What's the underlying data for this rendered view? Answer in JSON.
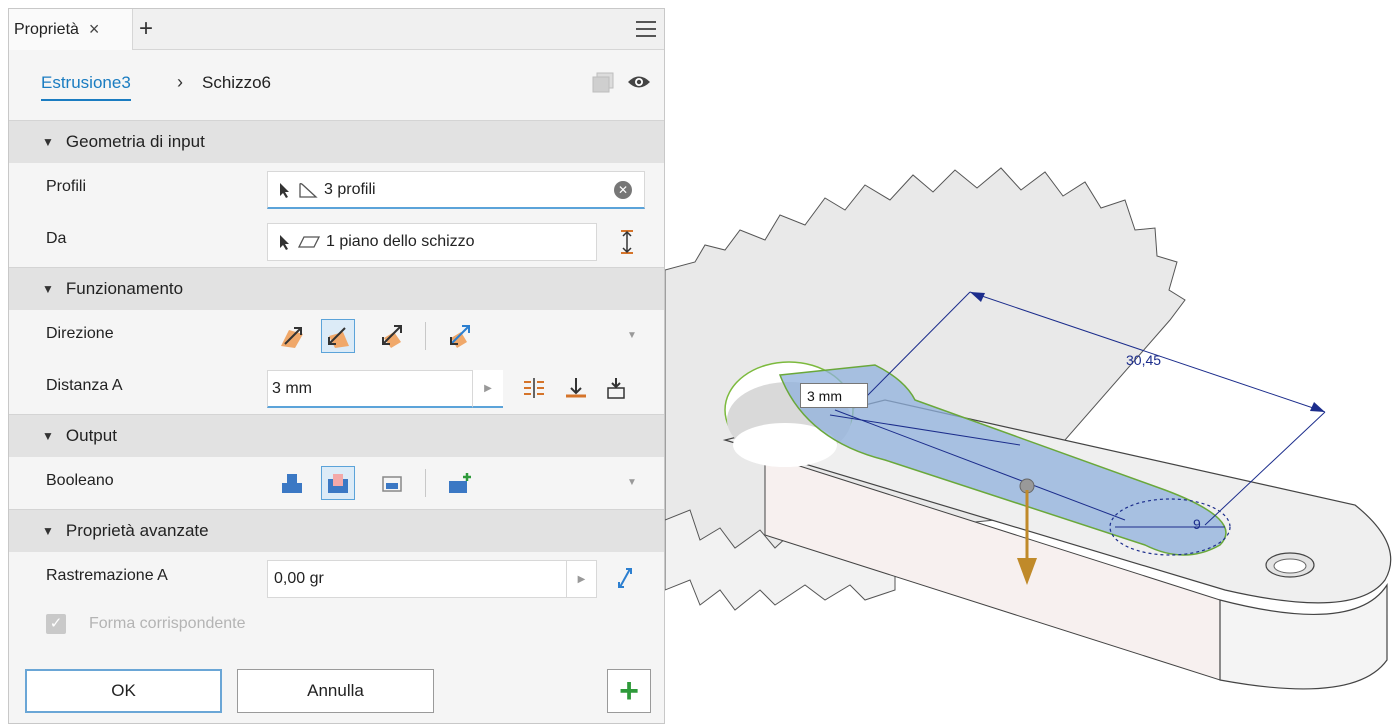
{
  "tab": {
    "label": "Proprietà",
    "close": "×",
    "add": "+"
  },
  "breadcrumb": {
    "link": "Estrusione3",
    "separator": "›",
    "current": "Schizzo6"
  },
  "sections": {
    "input_geometry": "Geometria di input",
    "behavior": "Funzionamento",
    "output": "Output",
    "advanced": "Proprietà avanzate"
  },
  "profiles": {
    "label": "Profili",
    "value": "3 profili"
  },
  "from": {
    "label": "Da",
    "value": "1 piano dello schizzo"
  },
  "direction": {
    "label": "Direzione"
  },
  "distance": {
    "label": "Distanza A",
    "value": "3 mm"
  },
  "boolean": {
    "label": "Booleano"
  },
  "taper": {
    "label": "Rastremazione A",
    "value": "0,00 gr"
  },
  "match_shape": {
    "label": "Forma corrispondente",
    "checked": true
  },
  "buttons": {
    "ok": "OK",
    "cancel": "Annulla",
    "plus": "+"
  },
  "viewport": {
    "dimension": "30,45",
    "distance_box": "3 mm",
    "hole_dim": "9"
  },
  "colors": {
    "accent": "#1a7cc1",
    "dimension": "#1c2d8c",
    "profile_fill": "#8fb0dc",
    "arrow": "#c08a2a"
  }
}
